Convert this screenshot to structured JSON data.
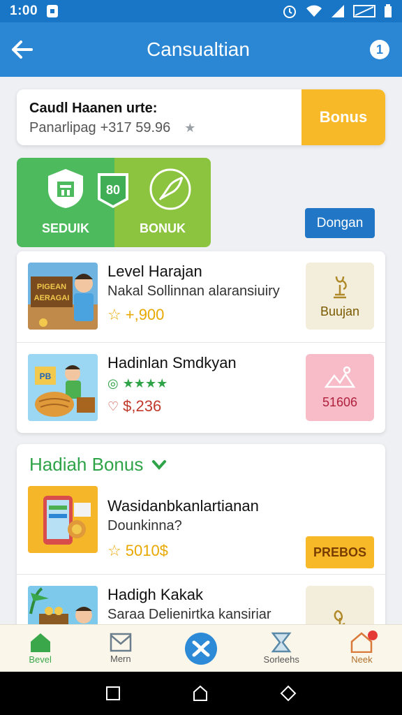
{
  "status_bar": {
    "time": "1:00"
  },
  "app_bar": {
    "title": "Cansualtian"
  },
  "summary": {
    "title": "Caudl Haanen urte:",
    "line_prefix": "Panarlipag",
    "line_value": "+317 59.96",
    "bonus_button": "Bonus"
  },
  "promo": {
    "left_label": "SEDUIK",
    "right_label": "BONUK",
    "mini_badge_text": "80"
  },
  "dongan_button": "Dongan",
  "list": [
    {
      "title": "Level Harajan",
      "subtitle": "Nakal Sollinnan alaransiuiry",
      "meta": "+,900",
      "meta_color": "#e8a800",
      "action_label": "Buujan",
      "action_bg": "#f3eedb",
      "action_color": "#7a5a00",
      "thumb_text_1": "PIGEAN",
      "thumb_text_2": "AERAGAI"
    },
    {
      "title": "Hadinlan Smdkyan",
      "subtitle": "",
      "stars": "★★★★",
      "meta": "$,236",
      "meta_color": "#c0392b",
      "action_label": "51606",
      "action_bg": "#f7bcc8",
      "action_color": "#b0203c",
      "thumb_text_1": "PB"
    }
  ],
  "bonus_section": {
    "title": "Hadiah Bonus",
    "items": [
      {
        "title": "Wasidanbkanlartianan",
        "subtitle": "Dounkinna?",
        "meta": "5010$",
        "action_label": "PREBOS"
      },
      {
        "title": "Hadigh Kakak",
        "subtitle": "Saraa Delienirtka kansiriar",
        "action_label": ""
      }
    ]
  },
  "bottom_nav": [
    {
      "label": "Bevel",
      "icon": "home-icon"
    },
    {
      "label": "Mern",
      "icon": "mail-icon"
    },
    {
      "label": "",
      "icon": "center-action-icon"
    },
    {
      "label": "Sorleehs",
      "icon": "hourglass-icon"
    },
    {
      "label": "Neek",
      "icon": "house-notify-icon"
    }
  ],
  "colors": {
    "primary": "#2b86d4",
    "status_bar": "#1976c6",
    "accent_yellow": "#f7b928",
    "accent_green": "#4dba5e"
  }
}
